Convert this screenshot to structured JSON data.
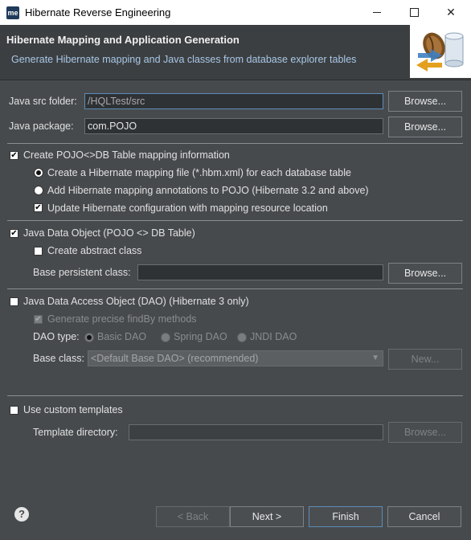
{
  "window": {
    "title": "Hibernate Reverse Engineering",
    "app_icon_text": "me",
    "minimize": "minimize-icon",
    "maximize": "maximize-icon",
    "close": "close-icon"
  },
  "header": {
    "title": "Hibernate Mapping and Application Generation",
    "description": "Generate Hibernate mapping and Java classes from database explorer tables"
  },
  "fields": {
    "java_src_label": "Java src folder:",
    "java_src_value": "/HQLTest/src",
    "java_package_label": "Java package:",
    "java_package_value": "com.POJO",
    "browse": "Browse..."
  },
  "mapping": {
    "create_label": "Create POJO<>DB Table mapping information",
    "create_checked": true,
    "option_hbm": "Create a Hibernate mapping file (*.hbm.xml) for each database table",
    "option_annotations": "Add Hibernate mapping annotations to POJO (Hibernate 3.2 and above)",
    "selected": "hbm",
    "update_config": "Update Hibernate configuration with mapping resource location",
    "update_config_checked": true
  },
  "pojo": {
    "label": "Java Data Object (POJO <> DB Table)",
    "checked": true,
    "abstract_label": "Create abstract class",
    "abstract_checked": false,
    "base_class_label": "Base persistent class:",
    "base_class_value": ""
  },
  "dao": {
    "label": "Java Data Access Object (DAO) (Hibernate 3 only)",
    "checked": false,
    "precise_label": "Generate precise findBy methods",
    "precise_checked": true,
    "type_label": "DAO type:",
    "type_basic": "Basic DAO",
    "type_spring": "Spring DAO",
    "type_jndi": "JNDI DAO",
    "base_class_label": "Base class:",
    "base_class_value": "<Default Base DAO> (recommended)",
    "new_button": "New..."
  },
  "templates": {
    "label": "Use custom templates",
    "checked": false,
    "dir_label": "Template directory:",
    "dir_value": ""
  },
  "footer": {
    "help": "?",
    "back": "< Back",
    "next": "Next >",
    "finish": "Finish",
    "cancel": "Cancel"
  },
  "colors": {
    "background": "#474a4d",
    "header_background": "#3c3f41",
    "focus_border": "#5d8cb8"
  }
}
